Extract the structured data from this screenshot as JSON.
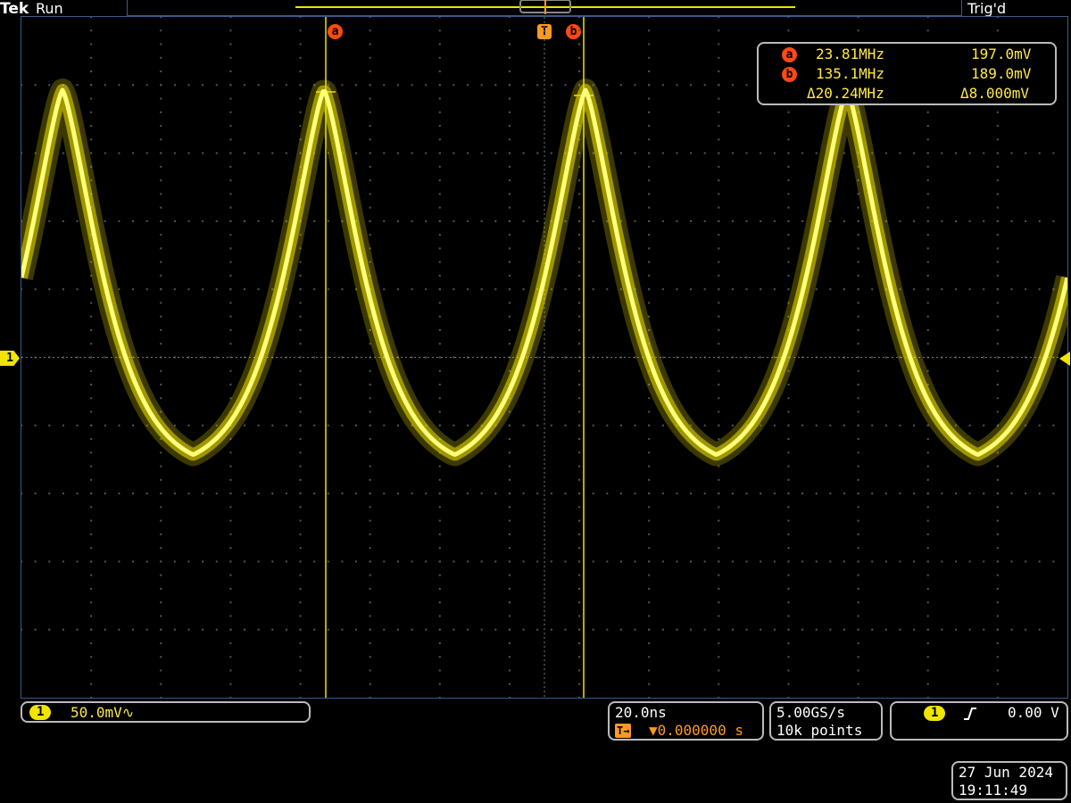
{
  "header": {
    "brand": "Tek",
    "run_state": "Run",
    "trigger_state": "Trig'd"
  },
  "cursors": {
    "a_label": "a",
    "b_label": "b",
    "trigger_marker": "T",
    "a_freq": "23.81MHz",
    "a_volt": "197.0mV",
    "b_freq": "135.1MHz",
    "b_volt": "189.0mV",
    "delta_freq": "Δ20.24MHz",
    "delta_volt": "Δ8.000mV"
  },
  "channel": {
    "number": "1",
    "scale": "50.0mV∿",
    "color": "#f0e400"
  },
  "timebase": {
    "scale": "20.0ns",
    "position": "▼0.000000 s",
    "position_icon": "T→"
  },
  "acquisition": {
    "sample_rate": "5.00GS/s",
    "record_length": "10k points"
  },
  "trigger": {
    "source": "1",
    "slope_icon": "rising-edge-icon",
    "level": "0.00 V"
  },
  "datetime": {
    "date": "27 Jun  2024",
    "time": "19:11:49"
  },
  "colors": {
    "trace": "#f0e400",
    "cursor_badge": "#ff4a12",
    "frame": "#3a5a8a"
  }
}
